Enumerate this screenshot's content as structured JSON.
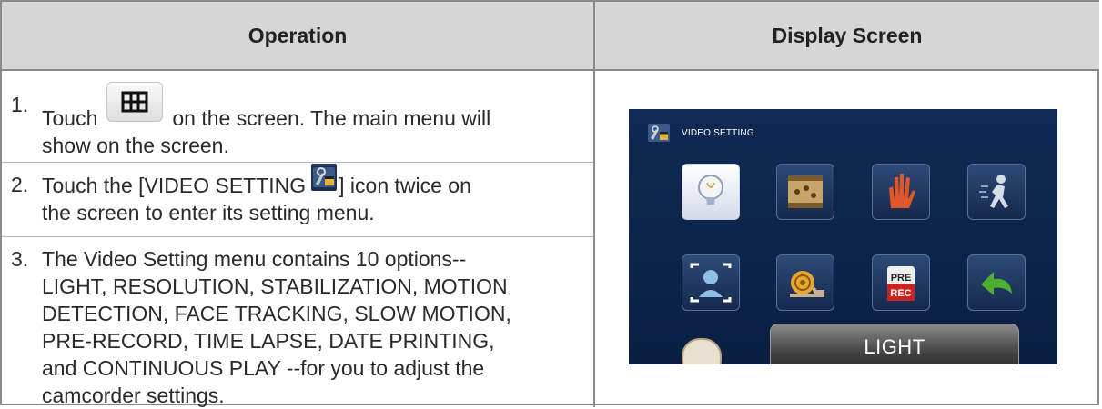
{
  "table": {
    "header_operation": "Operation",
    "header_display": "Display Screen"
  },
  "steps": [
    {
      "num": "1.",
      "text_before": "Touch",
      "icon": "grid-menu-icon",
      "text_after": "on the screen. The main menu will",
      "line2": "show on the screen."
    },
    {
      "num": "2.",
      "text_before": "Touch the [VIDEO SETTING",
      "icon": "video-setting-icon",
      "text_after": "] icon twice on",
      "line2": "the screen to enter its setting menu."
    },
    {
      "num": "3.",
      "lines": [
        "The Video Setting menu contains 10 options--",
        "LIGHT, RESOLUTION, STABILIZATION, MOTION",
        "DETECTION, FACE TRACKING, SLOW MOTION,",
        "PRE-RECORD, TIME LAPSE, DATE PRINTING,",
        "and CONTINUOUS PLAY --for you to adjust the",
        "camcorder settings."
      ]
    }
  ],
  "screen": {
    "title": "VIDEO SETTING",
    "selected_label": "LIGHT",
    "tiles": [
      {
        "name": "light-bulb-icon",
        "selected": true
      },
      {
        "name": "resolution-icon",
        "selected": false
      },
      {
        "name": "stabilization-hand-icon",
        "selected": false
      },
      {
        "name": "motion-detection-icon",
        "selected": false
      },
      {
        "name": "face-tracking-icon",
        "selected": false
      },
      {
        "name": "slow-motion-snail-icon",
        "selected": false
      },
      {
        "name": "pre-record-icon",
        "selected": false,
        "text_top": "PRE",
        "text_bottom": "REC"
      },
      {
        "name": "back-arrow-icon",
        "selected": false
      }
    ]
  },
  "colors": {
    "header_bg": "#d6d6d6",
    "border": "#8a8a8a",
    "screen_bg": "#0f2a55"
  }
}
